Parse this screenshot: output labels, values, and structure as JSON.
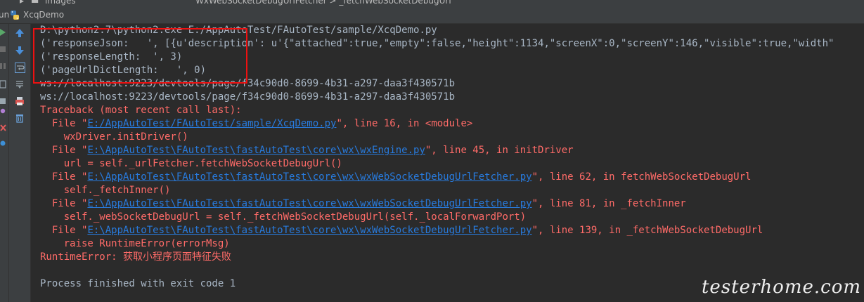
{
  "topStrip": {
    "folderLabel": "images",
    "crumbs": "WxWebSocketDebugUrlFetcher  >  _fetchWebSocketDebugUrl"
  },
  "runHeader": {
    "runLabel": "un",
    "tabTitle": "XcqDemo"
  },
  "console": {
    "lines": [
      {
        "text": "D:\\python2.7\\python2.exe E:/AppAutoTest/FAutoTest/sample/XcqDemo.py"
      },
      {
        "text": "('responseJson:   ', [{u'description': u'{\"attached\":true,\"empty\":false,\"height\":1134,\"screenX\":0,\"screenY\":146,\"visible\":true,\"width\""
      },
      {
        "text": "('responseLength:  ', 3)"
      },
      {
        "text": "('pageUrlDictLength:   ', 0)"
      },
      {
        "text": "ws://localhost:9223/devtools/page/f34c90d0-8699-4b31-a297-daa3f430571b"
      },
      {
        "text": "ws://localhost:9223/devtools/page/f34c90d0-8699-4b31-a297-daa3f430571b"
      },
      {
        "text": "Traceback (most recent call last):"
      },
      {
        "pre": "  File \"",
        "link": "E:/AppAutoTest/FAutoTest/sample/XcqDemo.py",
        "post": "\", line 16, in <module>"
      },
      {
        "text": "    wxDriver.initDriver()"
      },
      {
        "pre": "  File \"",
        "link": "E:\\AppAutoTest\\FAutoTest\\fastAutoTest\\core\\wx\\wxEngine.py",
        "post": "\", line 45, in initDriver"
      },
      {
        "text": "    url = self._urlFetcher.fetchWebSocketDebugUrl()"
      },
      {
        "pre": "  File \"",
        "link": "E:\\AppAutoTest\\FAutoTest\\fastAutoTest\\core\\wx\\wxWebSocketDebugUrlFetcher.py",
        "post": "\", line 62, in fetchWebSocketDebugUrl"
      },
      {
        "text": "    self._fetchInner()"
      },
      {
        "pre": "  File \"",
        "link": "E:\\AppAutoTest\\FAutoTest\\fastAutoTest\\core\\wx\\wxWebSocketDebugUrlFetcher.py",
        "post": "\", line 81, in _fetchInner"
      },
      {
        "text": "    self._webSocketDebugUrl = self._fetchWebSocketDebugUrl(self._localForwardPort)"
      },
      {
        "pre": "  File \"",
        "link": "E:\\AppAutoTest\\FAutoTest\\fastAutoTest\\core\\wx\\wxWebSocketDebugUrlFetcher.py",
        "post": "\", line 139, in _fetchWebSocketDebugUrl"
      },
      {
        "text": "    raise RuntimeError(errorMsg)"
      },
      {
        "text": "RuntimeError: 获取小程序页面特征失败"
      },
      {
        "text": ""
      },
      {
        "text": "Process finished with exit code 1"
      }
    ]
  },
  "watermark": "testerhome.com",
  "colors": {
    "background": "#2b2b2b",
    "stdout": "#a9b7c6",
    "stderr": "#ff6b68",
    "link": "#287bde",
    "highlight": "#ee1111"
  }
}
